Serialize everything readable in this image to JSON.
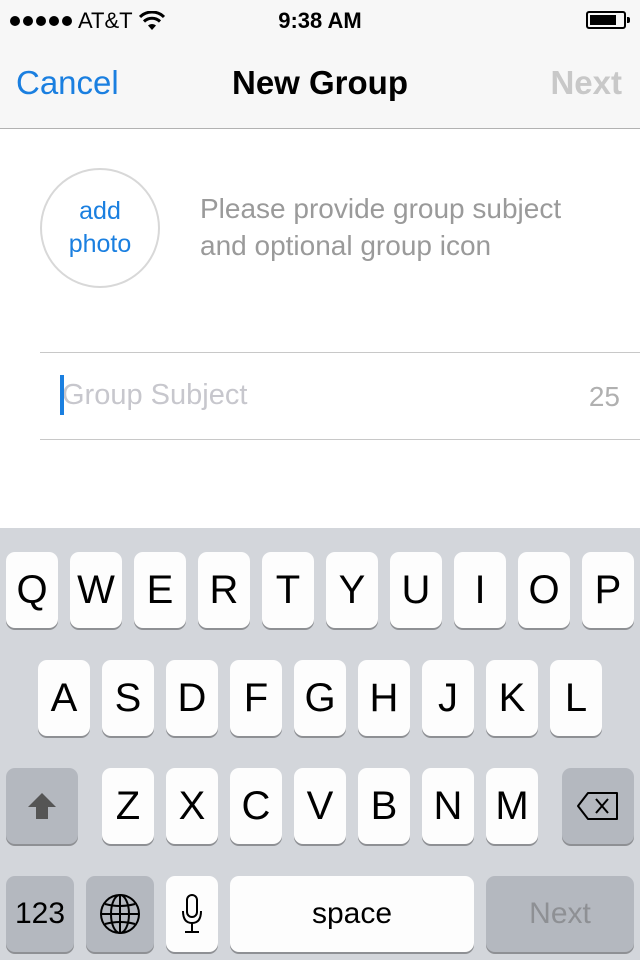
{
  "status_bar": {
    "signal_bars": 5,
    "carrier": "AT&T",
    "wifi_icon": "wifi-icon",
    "time": "9:38 AM",
    "battery_icon": "battery-icon"
  },
  "nav": {
    "cancel_label": "Cancel",
    "title": "New Group",
    "next_label": "Next"
  },
  "group_form": {
    "add_photo_line1": "add",
    "add_photo_line2": "photo",
    "hint_line1": "Please provide group subject",
    "hint_line2": "and optional group icon",
    "subject_value": "",
    "subject_placeholder": "Group Subject",
    "chars_remaining": "25"
  },
  "keyboard": {
    "row1": [
      "Q",
      "W",
      "E",
      "R",
      "T",
      "Y",
      "U",
      "I",
      "O",
      "P"
    ],
    "row2": [
      "A",
      "S",
      "D",
      "F",
      "G",
      "H",
      "J",
      "K",
      "L"
    ],
    "row3": [
      "Z",
      "X",
      "C",
      "V",
      "B",
      "N",
      "M"
    ],
    "shift_icon": "shift-icon",
    "delete_icon": "delete-icon",
    "numbers_label": "123",
    "globe_icon": "globe-icon",
    "mic_icon": "microphone-icon",
    "space_label": "space",
    "return_label": "Next"
  },
  "colors": {
    "accent": "#1a7fe0",
    "disabled": "#c8c8c8",
    "hint_text": "#9a9a9a",
    "keyboard_bg": "#d3d6db"
  }
}
